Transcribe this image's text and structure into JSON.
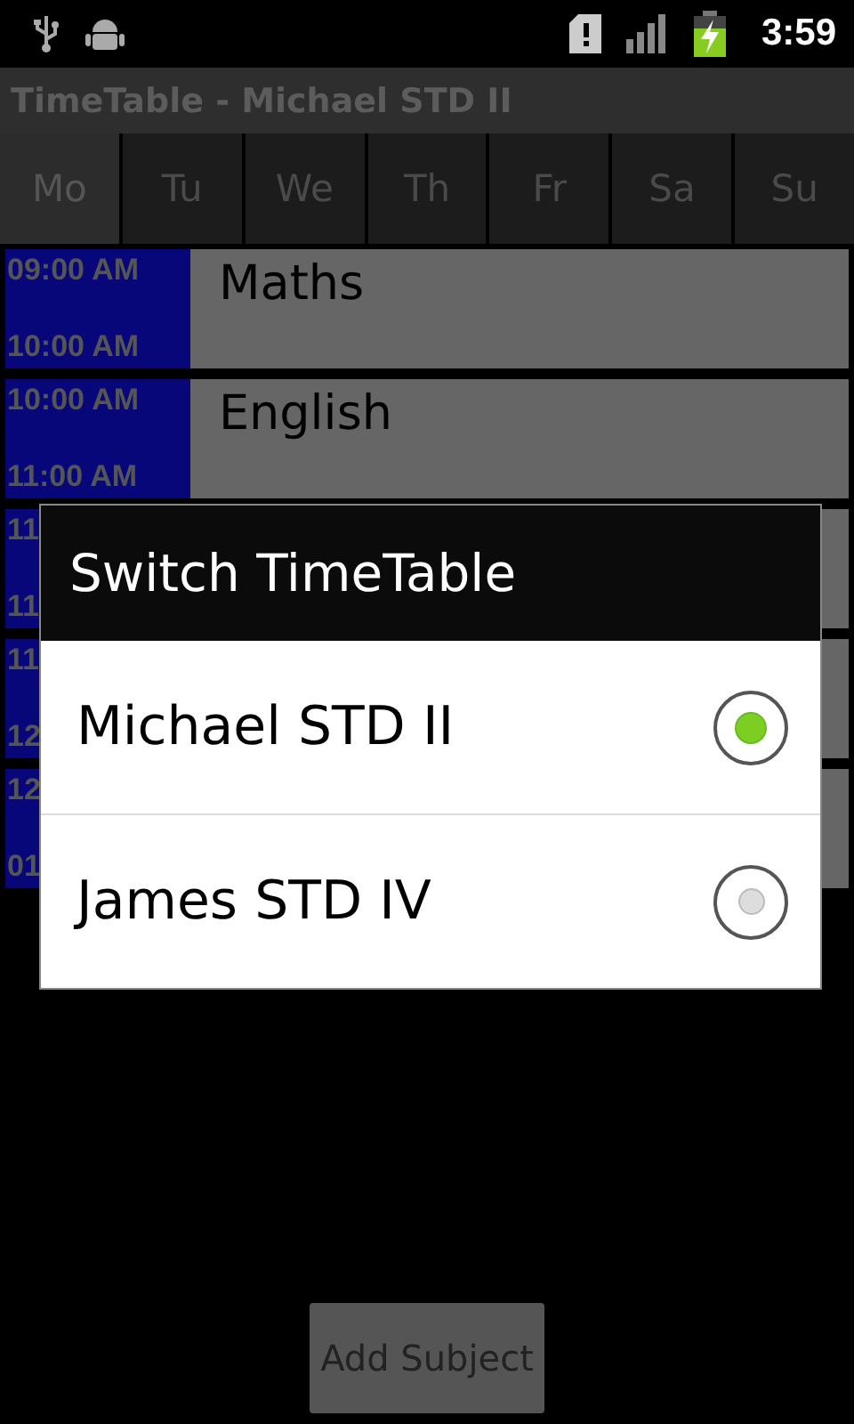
{
  "status_bar": {
    "time": "3:59"
  },
  "title_bar": {
    "title": "TimeTable - Michael STD II"
  },
  "day_tabs": [
    {
      "label": "Mo",
      "selected": true
    },
    {
      "label": "Tu",
      "selected": false
    },
    {
      "label": "We",
      "selected": false
    },
    {
      "label": "Th",
      "selected": false
    },
    {
      "label": "Fr",
      "selected": false
    },
    {
      "label": "Sa",
      "selected": false
    },
    {
      "label": "Su",
      "selected": false
    }
  ],
  "periods": [
    {
      "start": "09:00 AM",
      "end": "10:00 AM",
      "subject": "Maths"
    },
    {
      "start": "10:00 AM",
      "end": "11:00 AM",
      "subject": "English"
    },
    {
      "start": "11",
      "end": "11"
    },
    {
      "start": "11",
      "end": "12"
    },
    {
      "start": "12",
      "end": "01"
    }
  ],
  "dialog": {
    "title": "Switch TimeTable",
    "options": [
      {
        "label": "Michael STD II",
        "selected": true
      },
      {
        "label": "James STD IV",
        "selected": false
      }
    ]
  },
  "buttons": [
    "Add Subject"
  ]
}
